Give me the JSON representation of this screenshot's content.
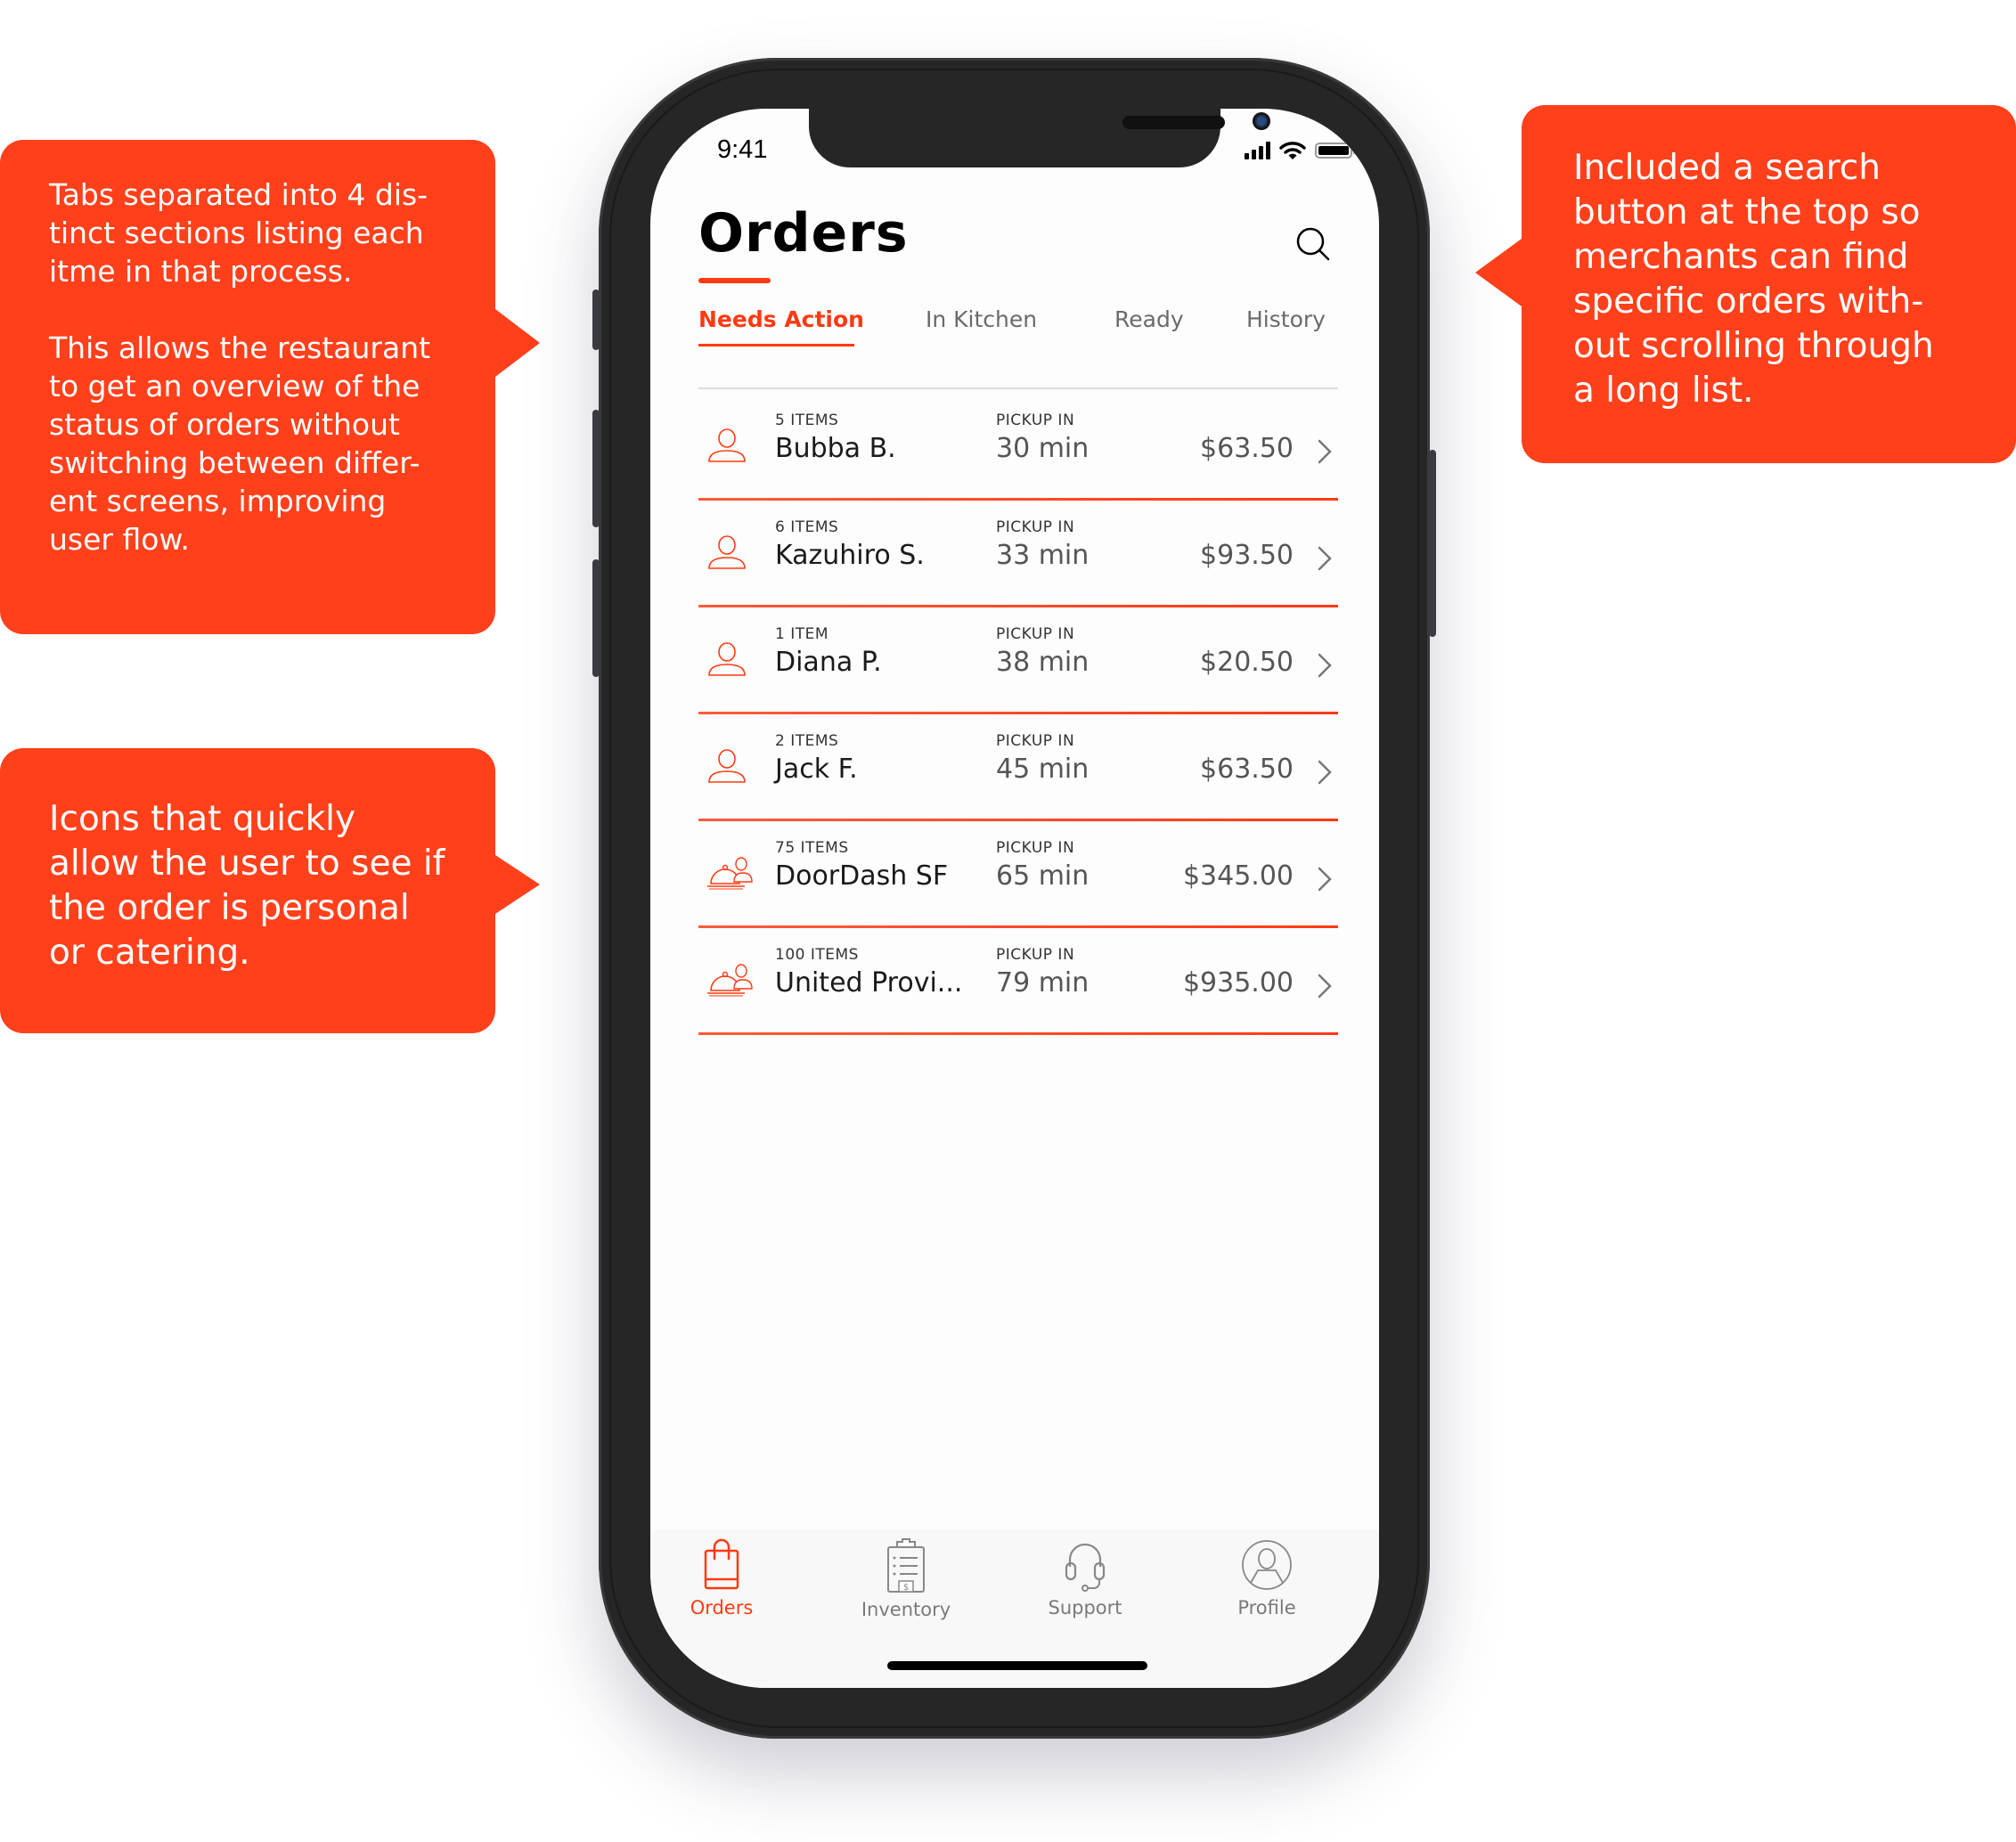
{
  "callouts": {
    "tabs_note": "Tabs separated into 4 dis-\ntinct sections listing each\nitme in that process.\n\nThis allows the restaurant\nto get an overview of the\nstatus of orders without\nswitching between differ-\nent screens, improving\nuser flow.",
    "icons_note": "Icons that quickly\nallow the user to see if\nthe order is personal\nor catering.",
    "search_note": "Included a search\nbutton at the top so\nmerchants can find\nspecific orders with-\nout scrolling through\na long list."
  },
  "status_bar": {
    "time": "9:41",
    "icons": [
      "signal-icon",
      "wifi-icon",
      "battery-icon"
    ]
  },
  "header": {
    "title": "Orders",
    "search_icon": "search-icon"
  },
  "tabs": [
    {
      "label": "Needs Action",
      "active": true
    },
    {
      "label": "In Kitchen",
      "active": false
    },
    {
      "label": "Ready",
      "active": false
    },
    {
      "label": "History",
      "active": false
    }
  ],
  "orders": [
    {
      "type": "personal",
      "icon": "person-icon",
      "items": "5 ITEMS",
      "name": "Bubba B.",
      "pickup_label": "PICKUP IN",
      "pickup": "30 min",
      "price": "$63.50"
    },
    {
      "type": "personal",
      "icon": "person-icon",
      "items": "6 ITEMS",
      "name": "Kazuhiro S.",
      "pickup_label": "PICKUP IN",
      "pickup": "33 min",
      "price": "$93.50"
    },
    {
      "type": "personal",
      "icon": "person-icon",
      "items": "1 ITEM",
      "name": "Diana P.",
      "pickup_label": "PICKUP IN",
      "pickup": "38 min",
      "price": "$20.50"
    },
    {
      "type": "personal",
      "icon": "person-icon",
      "items": "2 ITEMS",
      "name": "Jack F.",
      "pickup_label": "PICKUP IN",
      "pickup": "45 min",
      "price": "$63.50"
    },
    {
      "type": "catering",
      "icon": "catering-cloche-icon",
      "items": "75 ITEMS",
      "name": "DoorDash SF",
      "pickup_label": "PICKUP IN",
      "pickup": "65 min",
      "price": "$345.00"
    },
    {
      "type": "catering",
      "icon": "catering-cloche-icon",
      "items": "100 ITEMS",
      "name": "United Provi...",
      "pickup_label": "PICKUP IN",
      "pickup": "79 min",
      "price": "$935.00"
    }
  ],
  "tabbar": [
    {
      "label": "Orders",
      "icon": "shopping-bag-icon",
      "active": true
    },
    {
      "label": "Inventory",
      "icon": "clipboard-icon",
      "active": false
    },
    {
      "label": "Support",
      "icon": "headset-icon",
      "active": false
    },
    {
      "label": "Profile",
      "icon": "profile-icon",
      "active": false
    }
  ],
  "colors": {
    "accent": "#ff3a12",
    "callout": "#ff401b",
    "phone_frame": "#262626"
  }
}
